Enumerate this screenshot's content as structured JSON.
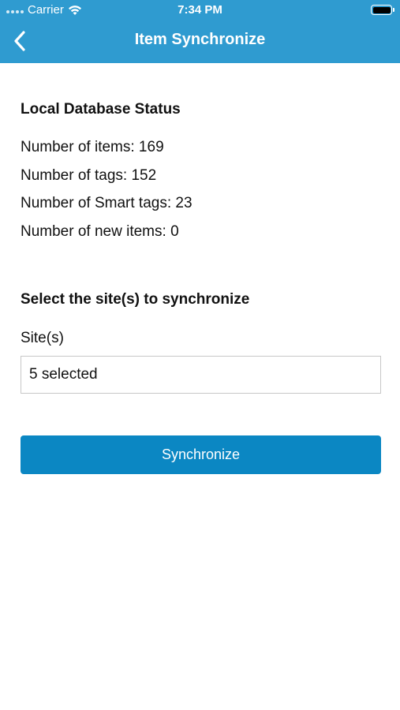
{
  "status_bar": {
    "carrier": "Carrier",
    "time": "7:34 PM"
  },
  "nav": {
    "title": "Item Synchronize"
  },
  "db_status": {
    "heading": "Local Database Status",
    "items": "Number of items: 169",
    "tags": "Number of tags: 152",
    "smart_tags": "Number of Smart tags: 23",
    "new_items": "Number of new items: 0"
  },
  "site_select": {
    "heading": "Select the site(s) to synchronize",
    "label": "Site(s)",
    "value": "5 selected"
  },
  "actions": {
    "synchronize_label": "Synchronize"
  },
  "colors": {
    "header": "#2f9bd0",
    "button": "#0b87c3"
  }
}
